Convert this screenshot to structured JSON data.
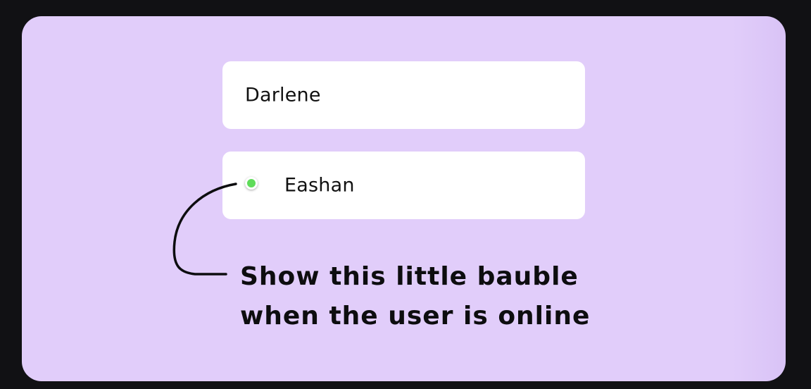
{
  "users": [
    {
      "name": "Darlene",
      "online": false
    },
    {
      "name": "Eashan",
      "online": true
    }
  ],
  "online_indicator": {
    "icon": "online-dot-icon",
    "color": "#5fdc5a"
  },
  "annotation": {
    "line1": "Show this little bauble",
    "line2": "when the user is online"
  },
  "colors": {
    "background": "#111114",
    "card": "#e1cdfa",
    "row": "#ffffff",
    "text": "#111111"
  }
}
